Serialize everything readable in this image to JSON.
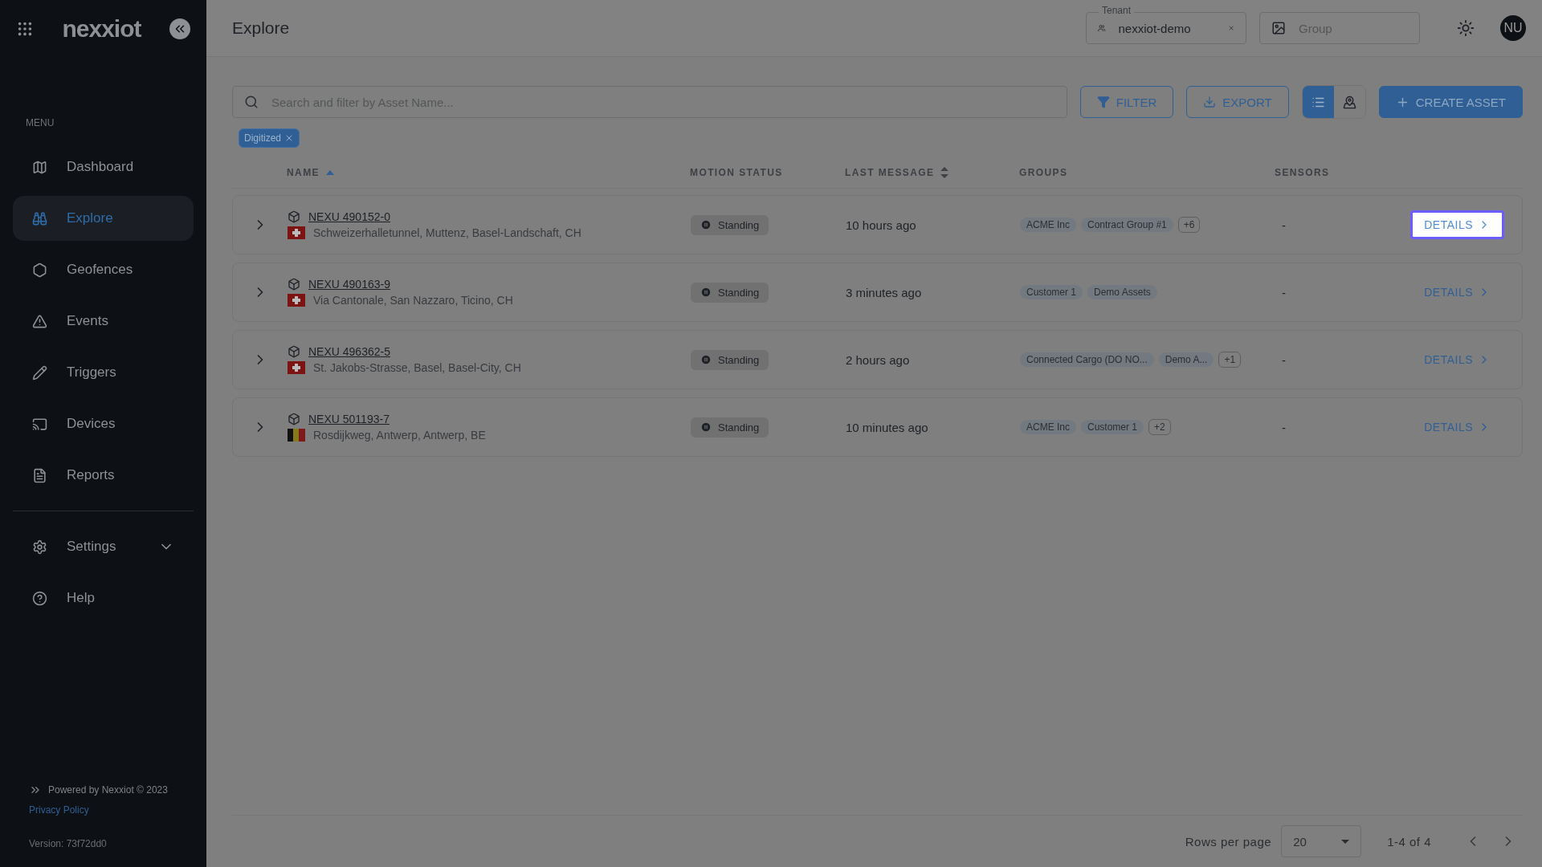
{
  "sidebar": {
    "logo": "nexxiot",
    "menu_label": "MENU",
    "items": [
      {
        "label": "Dashboard",
        "selected": false
      },
      {
        "label": "Explore",
        "selected": true
      },
      {
        "label": "Geofences",
        "selected": false
      },
      {
        "label": "Events",
        "selected": false
      },
      {
        "label": "Triggers",
        "selected": false
      },
      {
        "label": "Devices",
        "selected": false
      },
      {
        "label": "Reports",
        "selected": false
      }
    ],
    "bottom_items": [
      {
        "label": "Settings",
        "selected": false,
        "expanded": false
      },
      {
        "label": "Help",
        "selected": false
      }
    ],
    "footer": {
      "powered": "Powered by Nexxiot © 2023",
      "privacy": "Privacy Policy",
      "version": "Version: 73f72dd0"
    }
  },
  "header": {
    "title": "Explore",
    "tenant": {
      "label": "Tenant",
      "value": "nexxiot-demo"
    },
    "group": {
      "placeholder": "Group"
    },
    "avatar": "NU"
  },
  "toolbar": {
    "search": {
      "placeholder": "Search and filter by Asset Name..."
    },
    "filter": "FILTER",
    "export": "EXPORT",
    "view": [
      {
        "kind": "list",
        "selected": true
      },
      {
        "kind": "map",
        "selected": false
      }
    ],
    "create": "CREATE ASSET"
  },
  "chips": [
    "Digitized"
  ],
  "table": {
    "columns": [
      {
        "label": "NAME",
        "kind": "sorted"
      },
      {
        "label": "MOTION STATUS",
        "kind": "plain"
      },
      {
        "label": "LAST MESSAGE",
        "kind": "sortable"
      },
      {
        "label": "GROUPS",
        "kind": "plain"
      },
      {
        "label": "SENSORS",
        "kind": "plain"
      }
    ],
    "rows": [
      {
        "name": "NEXU 490152-0",
        "kind": "swiss",
        "location": "Schweizerhalletunnel, Muttenz, Basel-Landschaft, CH",
        "status": "Standing",
        "last": "10 hours ago",
        "groups": [
          {
            "kind": "tag",
            "label": "ACME Inc"
          },
          {
            "kind": "tag",
            "label": "Contract Group #1"
          },
          {
            "kind": "more",
            "label": "+6"
          }
        ],
        "sensors": "-",
        "details": "DETAILS",
        "highlighted": true
      },
      {
        "name": "NEXU 490163-9",
        "kind": "swiss",
        "location": "Via Cantonale, San Nazzaro, Ticino, CH",
        "status": "Standing",
        "last": "3 minutes ago",
        "groups": [
          {
            "kind": "tag",
            "label": "Customer 1"
          },
          {
            "kind": "tag",
            "label": "Demo Assets"
          }
        ],
        "sensors": "-",
        "details": "DETAILS",
        "highlighted": false
      },
      {
        "name": "NEXU 496362-5",
        "kind": "swiss",
        "location": "St. Jakobs-Strasse, Basel, Basel-City, CH",
        "status": "Standing",
        "last": "2 hours ago",
        "groups": [
          {
            "kind": "tag",
            "label": "Connected Cargo (DO NO..."
          },
          {
            "kind": "tag",
            "label": "Demo A..."
          },
          {
            "kind": "more",
            "label": "+1"
          }
        ],
        "sensors": "-",
        "details": "DETAILS",
        "highlighted": false
      },
      {
        "name": "NEXU 501193-7",
        "kind": "belgian",
        "location": "Rosdijkweg, Antwerp, Antwerp, BE",
        "status": "Standing",
        "last": "10 minutes ago",
        "groups": [
          {
            "kind": "tag",
            "label": "ACME Inc"
          },
          {
            "kind": "tag",
            "label": "Customer 1"
          },
          {
            "kind": "more",
            "label": "+2"
          }
        ],
        "sensors": "-",
        "details": "DETAILS",
        "highlighted": false
      }
    ]
  },
  "pagination": {
    "rows_label": "Rows per page",
    "rows_value": "20",
    "range": "1-4 of 4"
  }
}
